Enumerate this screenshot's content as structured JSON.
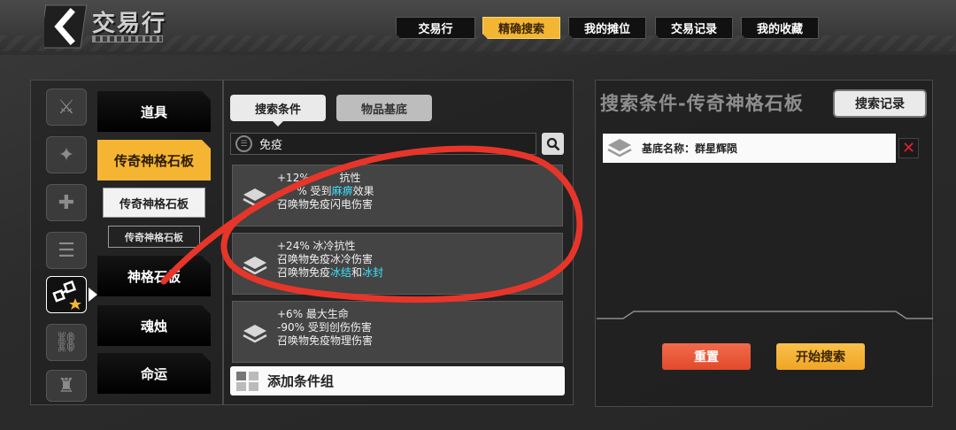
{
  "header": {
    "title": "交易行",
    "tabs": [
      {
        "label": "交易行",
        "active": false
      },
      {
        "label": "精确搜索",
        "active": true
      },
      {
        "label": "我的摊位",
        "active": false
      },
      {
        "label": "交易记录",
        "active": false
      },
      {
        "label": "我的收藏",
        "active": false
      }
    ]
  },
  "sidebar": {
    "icons": [
      "sword-cross-icon",
      "armor-cross-icon",
      "skill-cross-icon",
      "portrait-list-icon",
      "pattern-star-icon",
      "pattern-icon",
      "bag-icon"
    ],
    "selected_icon_index": 4,
    "categories": [
      {
        "label": "道具",
        "active": false
      },
      {
        "label": "传奇神格石板",
        "active": true
      },
      {
        "label": "神格石板",
        "active": false
      },
      {
        "label": "魂烛",
        "active": false
      },
      {
        "label": "命运",
        "active": false
      }
    ],
    "sub_item": "传奇神格石板",
    "sub_sub_item": "传奇神格石板"
  },
  "middle": {
    "tabs": [
      "搜索条件",
      "物品基底"
    ],
    "search_value": "免疫",
    "results": [
      {
        "lines": [
          [
            "+12% ",
            "",
            "抗性"
          ],
          [
            "-",
            "",
            "% 受到"
          ],
          [
            "召唤物免疫闪电伤害"
          ]
        ],
        "l1": "+12% ",
        "l1b": "抗性",
        "l2a": "-",
        "l2b": "% 受到",
        "l2hl": "麻痹",
        "l2c": "效果",
        "l3": "召唤物免疫闪电伤害"
      },
      {
        "l1": "+24% 冰冷抗性",
        "l2": "召唤物免疫冰冷伤害",
        "l3a": "召唤物免疫",
        "l3hl1": "冰结",
        "l3b": "和",
        "l3hl2": "冰封"
      },
      {
        "l1": "+6% 最大生命",
        "l2": "-90% 受到创伤伤害",
        "l3": "召唤物免疫物理伤害"
      }
    ],
    "add_group": "添加条件组"
  },
  "right": {
    "title": "搜索条件-传奇神格石板",
    "history_button": "搜索记录",
    "condition": "基底名称：群星辉陨",
    "reset_button": "重置",
    "start_button": "开始搜索"
  },
  "colors": {
    "accent": "#f5b533",
    "highlight": "#3de0ff",
    "annotation": "#e8352a"
  }
}
